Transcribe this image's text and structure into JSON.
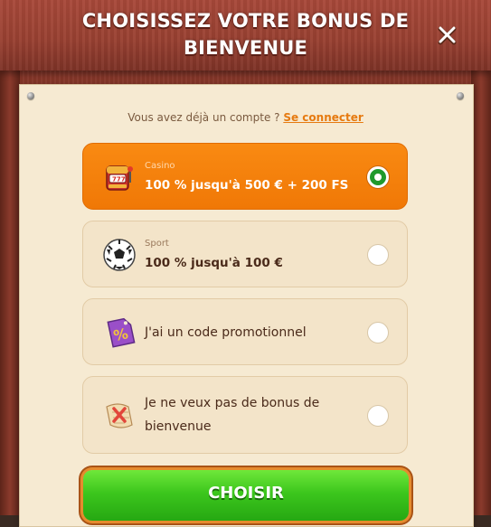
{
  "header": {
    "title_line1": "CHOISISSEZ VOTRE BONUS DE",
    "title_line2": "BIENVENUE"
  },
  "login": {
    "prompt": "Vous avez déjà un compte ? ",
    "link_label": "Se connecter"
  },
  "options": [
    {
      "icon": "slot-machine-icon",
      "category": "Casino",
      "label": "100 % jusqu'à 500 € + 200 FS",
      "selected": true
    },
    {
      "icon": "soccer-ball-icon",
      "category": "Sport",
      "label": "100 % jusqu'à 100 €",
      "selected": false
    },
    {
      "icon": "promo-tag-icon",
      "label": "J'ai un code promotionnel",
      "selected": false
    },
    {
      "icon": "no-bonus-icon",
      "label_line1": "Je ne veux pas de bonus de",
      "label_line2": "bienvenue",
      "selected": false
    }
  ],
  "actions": {
    "choose_label": "CHOISIR"
  },
  "colors": {
    "accent_orange": "#f07806",
    "choose_green": "#3cc61d",
    "wood_red": "#9a4132",
    "parchment": "#f6ead2"
  }
}
